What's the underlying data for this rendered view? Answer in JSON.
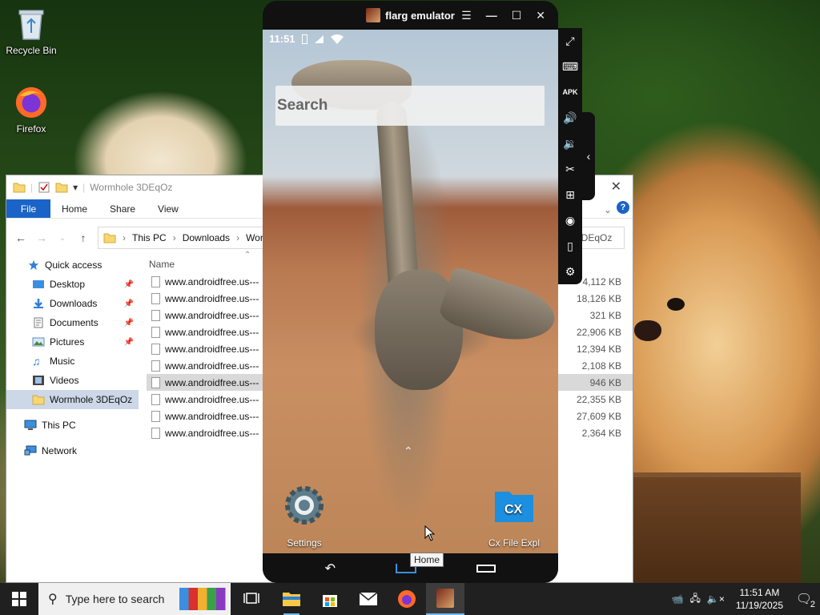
{
  "desktop": {
    "icons": [
      {
        "label": "Recycle Bin",
        "icon": "recycle-bin-icon"
      },
      {
        "label": "Firefox",
        "icon": "firefox-icon"
      }
    ]
  },
  "explorer": {
    "title": "Wormhole 3DEqOz",
    "ribbon_tabs": [
      "File",
      "Home",
      "Share",
      "View"
    ],
    "breadcrumb": [
      "This PC",
      "Downloads",
      "Worm"
    ],
    "search_partial": "3DEqOz",
    "column_name": "Name",
    "nav": [
      {
        "label": "Quick access",
        "icon": "star-icon",
        "pinned": false
      },
      {
        "label": "Desktop",
        "icon": "desktop-folder-icon",
        "pinned": true
      },
      {
        "label": "Downloads",
        "icon": "downloads-icon",
        "pinned": true
      },
      {
        "label": "Documents",
        "icon": "documents-icon",
        "pinned": true
      },
      {
        "label": "Pictures",
        "icon": "pictures-icon",
        "pinned": true
      },
      {
        "label": "Music",
        "icon": "music-icon",
        "pinned": false
      },
      {
        "label": "Videos",
        "icon": "videos-icon",
        "pinned": false
      },
      {
        "label": "Wormhole 3DEqOz",
        "icon": "folder-icon",
        "pinned": false
      },
      {
        "label": "This PC",
        "icon": "this-pc-icon",
        "pinned": false
      },
      {
        "label": "Network",
        "icon": "network-icon",
        "pinned": false
      }
    ],
    "files": [
      {
        "name": "www.androidfree.us---",
        "size": "4,112 KB"
      },
      {
        "name": "www.androidfree.us---",
        "size": "18,126 KB"
      },
      {
        "name": "www.androidfree.us---",
        "size": "321 KB"
      },
      {
        "name": "www.androidfree.us---",
        "size": "22,906 KB"
      },
      {
        "name": "www.androidfree.us---",
        "size": "12,394 KB"
      },
      {
        "name": "www.androidfree.us---",
        "size": "2,108 KB"
      },
      {
        "name": "www.androidfree.us---",
        "size": "946 KB"
      },
      {
        "name": "www.androidfree.us---",
        "size": "22,355 KB"
      },
      {
        "name": "www.androidfree.us---",
        "size": "27,609 KB"
      },
      {
        "name": "www.androidfree.us---",
        "size": "2,364 KB"
      }
    ]
  },
  "emulator": {
    "title": "flarg emulator",
    "status_time": "11:51",
    "search_placeholder": "Search",
    "apps": [
      {
        "label": "Settings",
        "icon": "settings-gear-icon"
      },
      {
        "label": "Cx File Expl",
        "icon": "cx-file-explorer-icon"
      }
    ],
    "home_tooltip": "Home",
    "sidebar_icons": [
      "fullscreen-icon",
      "keyboard-icon",
      "apk-install-icon",
      "volume-up-icon",
      "volume-down-icon",
      "scissors-icon",
      "add-window-icon",
      "location-icon",
      "shake-icon",
      "settings-icon"
    ]
  },
  "taskbar": {
    "search_placeholder": "Type here to search",
    "apps": [
      "task-view-icon",
      "file-explorer-icon",
      "store-icon",
      "mail-icon",
      "firefox-icon",
      "flarg-emulator-icon"
    ],
    "time": "11:51 AM",
    "date": "11/19/2025",
    "notifications": "2"
  },
  "colors": {
    "accent": "#1a64c7",
    "taskbar": "#202020",
    "selection": "#ccd7e8"
  }
}
